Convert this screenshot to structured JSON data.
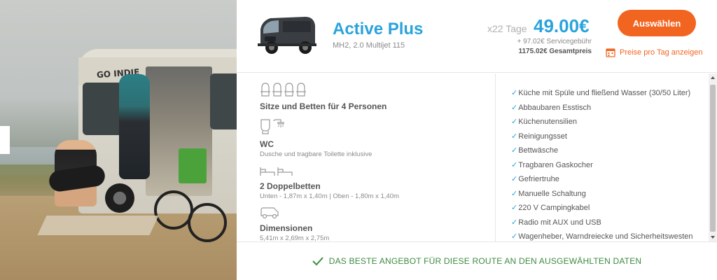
{
  "listing": {
    "title": "Active Plus",
    "subtitle": "MH2, 2.0 Multijet 115",
    "days": "x22 Tage",
    "price": "49.00€",
    "service_fee": "+ 97.02€ Servicegebühr",
    "total_price": "1175.02€ Gesamtpreis",
    "select_label": "Auswählen",
    "per_day_label": "Preise pro Tag anzeigen"
  },
  "photo": {
    "van_logo": "GO INDIE"
  },
  "features": [
    {
      "icon": "seat-icon",
      "heading": "Sitze und Betten für 4 Personen",
      "detail": ""
    },
    {
      "icon": "wc-shower-icon",
      "heading": "WC",
      "detail": "Dusche und tragbare Toilette inklusive"
    },
    {
      "icon": "double-bed-icon",
      "heading": "2 Doppelbetten",
      "detail": "Unten - 1,87m x 1,40m | Oben - 1,80m x 1,40m"
    },
    {
      "icon": "van-dimensions-icon",
      "heading": "Dimensionen",
      "detail": "5,41m x 2,69m x 2,75m"
    }
  ],
  "amenities": [
    "Küche mit Spüle und fließend Wasser (30/50 Liter)",
    "Abbaubaren Esstisch",
    "Küchenutensilien",
    "Reinigungsset",
    "Bettwäsche",
    "Tragbaren Gaskocher",
    "Gefriertruhe",
    "Manuelle Schaltung",
    "220 V Campingkabel",
    "Radio mit AUX und USB",
    "Wagenheber, Warndreiecke und Sicherheitswesten"
  ],
  "footer": {
    "text": "DAS BESTE ANGEBOT FÜR DIESE ROUTE AN DEN AUSGEWÄHLTEN DATEN"
  },
  "colors": {
    "accent_blue": "#2aa3dc",
    "accent_orange": "#f26521",
    "success_green": "#3d8b40"
  }
}
